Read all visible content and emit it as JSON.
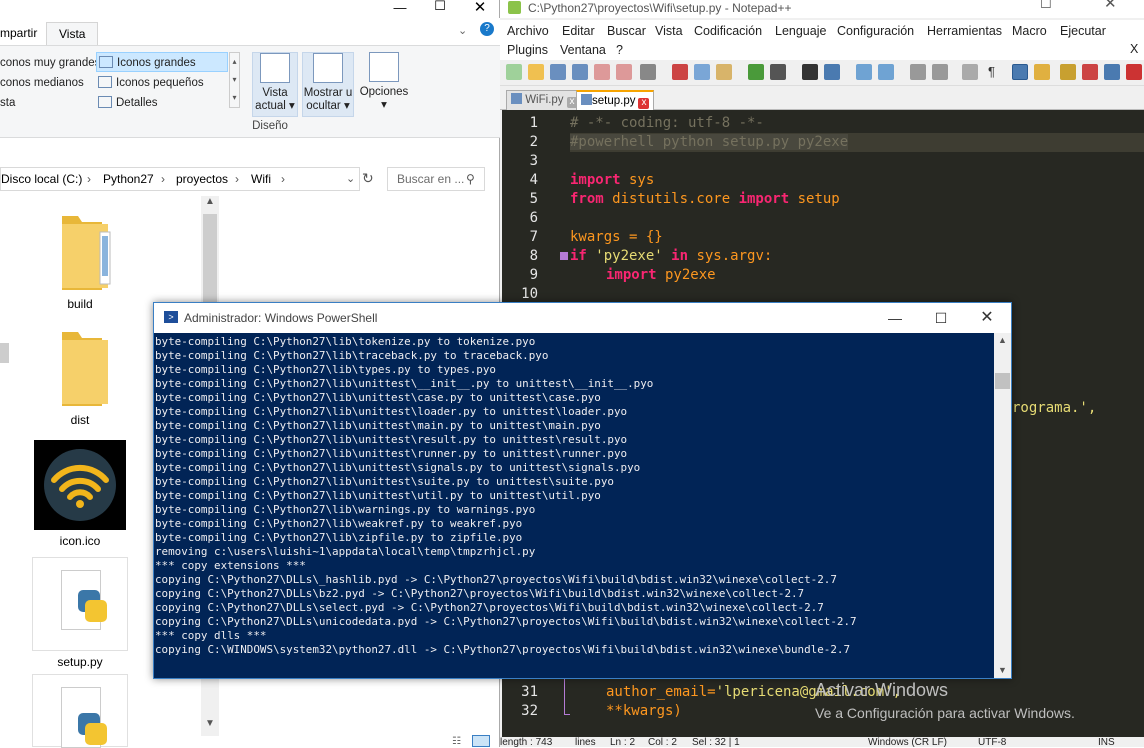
{
  "explorer": {
    "tab_share": "mpartir",
    "tab_view": "Vista",
    "layout_items": [
      "conos muy grandes",
      "conos medianos",
      "sta"
    ],
    "layout_items_right": [
      "Iconos grandes",
      "Iconos pequeños",
      "Detalles"
    ],
    "btn_current_view": [
      "Vista",
      "actual"
    ],
    "btn_show_hide": [
      "Mostrar u",
      "ocultar"
    ],
    "btn_options": "Opciones",
    "group_label": "Diseño",
    "breadcrumbs": [
      "Disco local (C:)",
      "Python27",
      "proyectos",
      "Wifi"
    ],
    "search_placeholder": "Buscar en ...",
    "files": [
      {
        "name": "build",
        "icon": "folder-icon"
      },
      {
        "name": "dist",
        "icon": "folder-icon"
      },
      {
        "name": "icon.ico",
        "icon": "wifi-icon"
      },
      {
        "name": "setup.py",
        "icon": "python-file-icon"
      },
      {
        "name": "",
        "icon": "python-file-icon"
      }
    ]
  },
  "notepad": {
    "title": "C:\\Python27\\proyectos\\Wifi\\setup.py - Notepad++",
    "menus_row1": [
      "Archivo",
      "Editar",
      "Buscar",
      "Vista",
      "Codificación",
      "Lenguaje",
      "Configuración",
      "Herramientas",
      "Macro",
      "Ejecutar"
    ],
    "menus_row2": [
      "Plugins",
      "Ventana",
      "?"
    ],
    "menu_close": "X",
    "tabs": [
      {
        "label": "WiFi.py",
        "active": false
      },
      {
        "label": "setup.py",
        "active": true
      }
    ],
    "line_numbers": [
      "1",
      "2",
      "3",
      "4",
      "5",
      "6",
      "7",
      "8",
      "9",
      "10"
    ],
    "bottom_line_numbers": [
      "31",
      "32"
    ],
    "fragment_right": "rograma.',",
    "status": [
      "length : 743",
      "lines",
      "Ln : 2",
      "Col : 2",
      "Sel : 32 | 1",
      "Windows (CR LF)",
      "UTF-8",
      "INS"
    ]
  },
  "code": {
    "l1": "# -*- coding: utf-8 -*-",
    "l2": "#powerhell python setup.py py2exe",
    "l4_kw": "import",
    "l4_rest": " sys",
    "l5_kw1": "from",
    "l5_mid": " distutils.core ",
    "l5_kw2": "import",
    "l5_rest": " setup",
    "l7": "kwargs = {}",
    "l8_kw": "if",
    "l8_str": " 'py2exe'",
    "l8_kw2": " in",
    "l8_rest": " sys.argv:",
    "l9_kw": "import",
    "l9_rest": " py2exe",
    "l31_a": "author_email=",
    "l31_b": "'lpericena@gmail.com',",
    "l32": "**kwargs)"
  },
  "powershell": {
    "title": "Administrador: Windows PowerShell",
    "lines": [
      "byte-compiling C:\\Python27\\lib\\tokenize.py to tokenize.pyo",
      "byte-compiling C:\\Python27\\lib\\traceback.py to traceback.pyo",
      "byte-compiling C:\\Python27\\lib\\types.py to types.pyo",
      "byte-compiling C:\\Python27\\lib\\unittest\\__init__.py to unittest\\__init__.pyo",
      "byte-compiling C:\\Python27\\lib\\unittest\\case.py to unittest\\case.pyo",
      "byte-compiling C:\\Python27\\lib\\unittest\\loader.py to unittest\\loader.pyo",
      "byte-compiling C:\\Python27\\lib\\unittest\\main.py to unittest\\main.pyo",
      "byte-compiling C:\\Python27\\lib\\unittest\\result.py to unittest\\result.pyo",
      "byte-compiling C:\\Python27\\lib\\unittest\\runner.py to unittest\\runner.pyo",
      "byte-compiling C:\\Python27\\lib\\unittest\\signals.py to unittest\\signals.pyo",
      "byte-compiling C:\\Python27\\lib\\unittest\\suite.py to unittest\\suite.pyo",
      "byte-compiling C:\\Python27\\lib\\unittest\\util.py to unittest\\util.pyo",
      "byte-compiling C:\\Python27\\lib\\warnings.py to warnings.pyo",
      "byte-compiling C:\\Python27\\lib\\weakref.py to weakref.pyo",
      "byte-compiling C:\\Python27\\lib\\zipfile.py to zipfile.pyo",
      "removing c:\\users\\luishi~1\\appdata\\local\\temp\\tmpzrhjcl.py",
      "*** copy extensions ***",
      "copying C:\\Python27\\DLLs\\_hashlib.pyd -> C:\\Python27\\proyectos\\Wifi\\build\\bdist.win32\\winexe\\collect-2.7",
      "copying C:\\Python27\\DLLs\\bz2.pyd -> C:\\Python27\\proyectos\\Wifi\\build\\bdist.win32\\winexe\\collect-2.7",
      "copying C:\\Python27\\DLLs\\select.pyd -> C:\\Python27\\proyectos\\Wifi\\build\\bdist.win32\\winexe\\collect-2.7",
      "copying C:\\Python27\\DLLs\\unicodedata.pyd -> C:\\Python27\\proyectos\\Wifi\\build\\bdist.win32\\winexe\\collect-2.7",
      "*** copy dlls ***",
      "copying C:\\WINDOWS\\system32\\python27.dll -> C:\\Python27\\proyectos\\Wifi\\build\\bdist.win32\\winexe\\bundle-2.7"
    ]
  },
  "watermark": {
    "line1": "Activar Windows",
    "line2": "Ve a Configuración para activar Windows."
  },
  "colors": {
    "ps_bg": "#012456",
    "editor_bg": "#272822",
    "keyword": "#f92672",
    "string": "#e6db74",
    "comment": "#75715e"
  }
}
